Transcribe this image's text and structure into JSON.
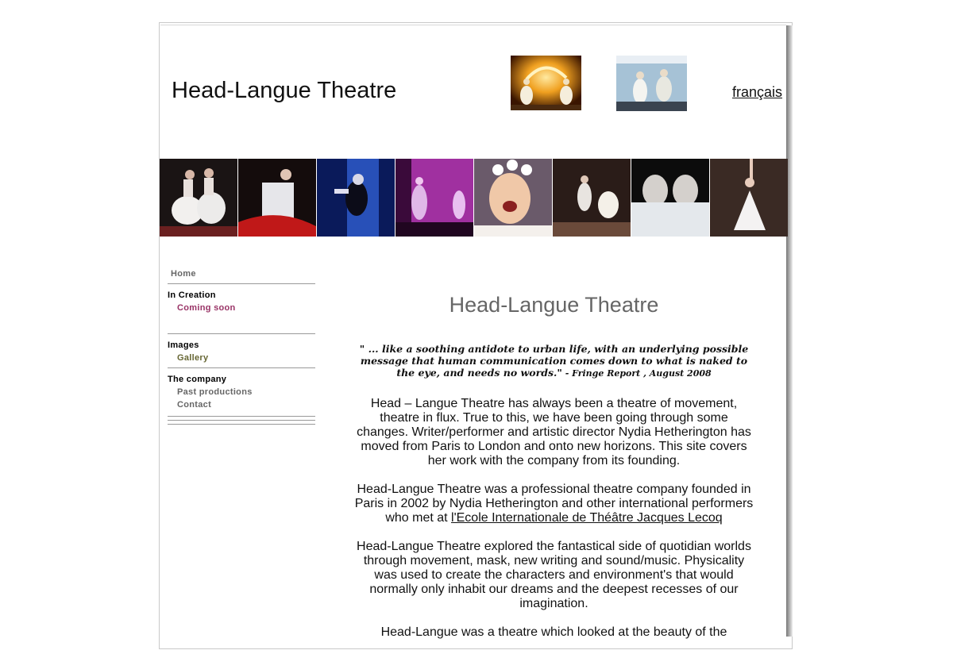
{
  "header": {
    "title": "Head-Langue Theatre",
    "language_link": "français"
  },
  "nav": {
    "home": "Home",
    "sections": [
      {
        "title": "In Creation",
        "items": [
          {
            "label": "Coming soon",
            "color": "#993366"
          }
        ]
      },
      {
        "title": "Images",
        "items": [
          {
            "label": "Gallery",
            "color": "#666633"
          }
        ]
      },
      {
        "title": "The company",
        "items": [
          {
            "label": "Past productions",
            "color": "#666666"
          },
          {
            "label": "Contact",
            "color": "#666666"
          }
        ]
      }
    ]
  },
  "main": {
    "heading": "Head-Langue Theatre",
    "quote": {
      "text": "\" ... like a soothing antidote to urban life, with an underlying possible message that human communication comes down to what is naked to the eye, and needs no words.\"",
      "source": " - Fringe Report , August 2008"
    },
    "paragraphs": [
      {
        "text": "Head – Langue Theatre has always been a theatre of movement, theatre in flux. True to this, we have been going through some changes. Writer/performer and  artistic director Nydia Hetherington has moved from Paris to London and onto new horizons. This site covers her work with the company from its founding."
      },
      {
        "text": "Head-Langue Theatre was a professional theatre company founded in Paris in 2002 by Nydia Hetherington and other international performers who met at ",
        "link": "l'Ecole Internationale de Théâtre Jacques Lecoq"
      },
      {
        "text": "Head-Langue Theatre explored the fantastical side of quotidian worlds through movement, mask, new writing and sound/music. Physicality was used to create the characters and environment's that would normally only inhabit our dreams and the deepest recesses of our imagination."
      },
      {
        "text": "Head-Langue was a  theatre which looked at the beauty of the"
      }
    ]
  },
  "colors": {
    "heading": "#666666",
    "nav_rule": "#999999"
  }
}
